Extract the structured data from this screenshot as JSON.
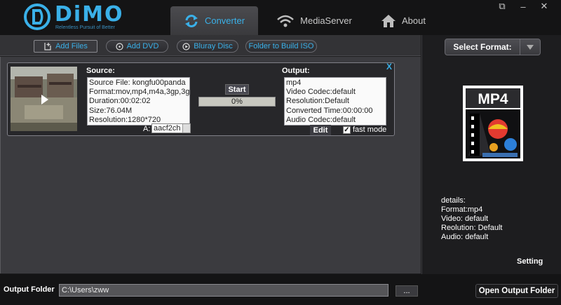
{
  "app": {
    "logo_text": "DiMO",
    "tagline": "Relentless Pursuit of Better",
    "brand_color": "#3ab0e8"
  },
  "tabs": [
    {
      "label": "Converter",
      "icon": "refresh-icon",
      "active": true
    },
    {
      "label": "MediaServer",
      "icon": "wifi-icon",
      "active": false
    },
    {
      "label": "About",
      "icon": "home-icon",
      "active": false
    }
  ],
  "window_controls": {
    "popout": "⧉",
    "minimize": "–",
    "close": "✕"
  },
  "toolbar": {
    "add_files": "Add Files",
    "add_dvd": "Add DVD",
    "bluray": "Bluray Disc",
    "folder_iso": "Folder to Build ISO"
  },
  "item": {
    "source_label": "Source:",
    "source_lines": [
      "Source File: kongfu00panda",
      "Format:mov,mp4,m4a,3gp,3g",
      "Duration:00:02:02",
      "Size:76.04M",
      "Resolution:1280*720"
    ],
    "start_label": "Start",
    "progress_text": "0%",
    "progress_fraction": 0,
    "output_label": "Output:",
    "output_lines": [
      "mp4",
      "Video Codec:default",
      "Resolution:Default",
      "Converted Time:00:00:00",
      "Audio Codec:default"
    ],
    "audio_label": "A:",
    "audio_value": "aacf2ch",
    "edit_label": "Edit",
    "fast_mode_label": "fast mode",
    "fast_mode_checked": true,
    "close_label": "X"
  },
  "right_panel": {
    "select_format_label": "Select Format:",
    "format_icon_text": "MP4",
    "details": [
      "details:",
      "Format:mp4",
      "Video: default",
      "Reolution: Default",
      "Audio: default"
    ],
    "setting_label": "Setting"
  },
  "bottom": {
    "output_folder_label": "Output Folder",
    "output_folder_value": "C:\\Users\\zww",
    "browse_label": "...",
    "open_output_label": "Open Output Folder"
  }
}
